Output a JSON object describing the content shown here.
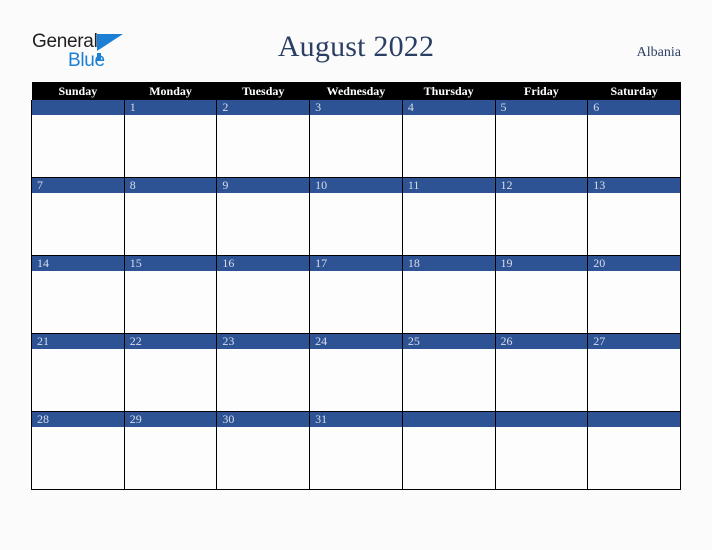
{
  "brand": {
    "name_part1": "General",
    "name_part2": "Blue",
    "triangle_color": "#1b7fd4",
    "text_color": "#231f20"
  },
  "header": {
    "title": "August 2022",
    "country": "Albania"
  },
  "theme": {
    "header_bar_color": "#000000",
    "date_bar_color": "#2e5394",
    "date_text_color": "#d7dde9",
    "cell_bg_color": "#fdfdfd",
    "page_bg_color": "#fbfbfb",
    "title_color": "#2b3e63"
  },
  "calendar": {
    "month": "August",
    "year": "2022",
    "weekday_headers": [
      "Sunday",
      "Monday",
      "Tuesday",
      "Wednesday",
      "Thursday",
      "Friday",
      "Saturday"
    ],
    "weeks": [
      [
        "",
        "1",
        "2",
        "3",
        "4",
        "5",
        "6"
      ],
      [
        "7",
        "8",
        "9",
        "10",
        "11",
        "12",
        "13"
      ],
      [
        "14",
        "15",
        "16",
        "17",
        "18",
        "19",
        "20"
      ],
      [
        "21",
        "22",
        "23",
        "24",
        "25",
        "26",
        "27"
      ],
      [
        "28",
        "29",
        "30",
        "31",
        "",
        "",
        ""
      ]
    ]
  }
}
